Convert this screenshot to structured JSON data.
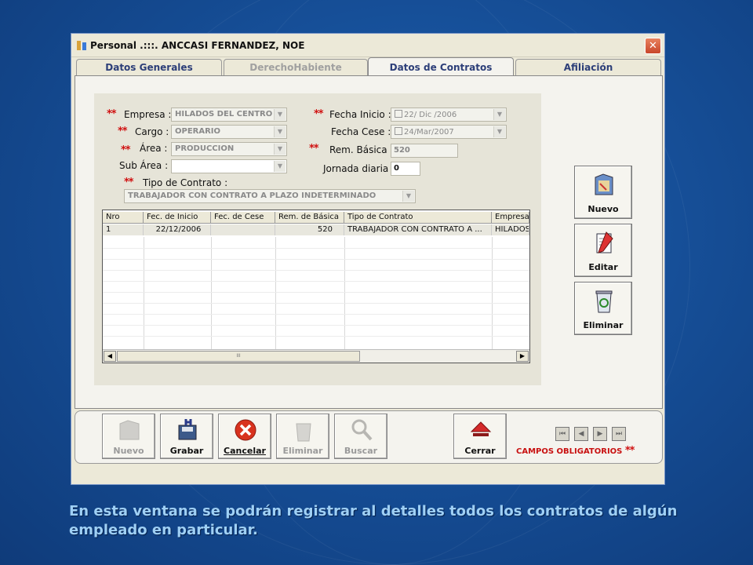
{
  "window": {
    "title": "Personal .:::. ANCCASI FERNANDEZ, NOE",
    "close_glyph": "✕"
  },
  "tabs": [
    {
      "label": "Datos Generales",
      "state": "normal"
    },
    {
      "label": "DerechoHabiente",
      "state": "disabled"
    },
    {
      "label": "Datos de Contratos",
      "state": "active"
    },
    {
      "label": "Afiliación",
      "state": "normal"
    }
  ],
  "form": {
    "required_mark": "**",
    "empresa": {
      "label": "Empresa :",
      "value": "HILADOS DEL CENTRO S"
    },
    "cargo": {
      "label": "Cargo :",
      "value": "OPERARIO"
    },
    "area": {
      "label": "Área :",
      "value": "PRODUCCION"
    },
    "sub_area": {
      "label": "Sub Área :",
      "value": ""
    },
    "fecha_inicio": {
      "label": "Fecha Inicio :",
      "value": "22/ Dic /2006"
    },
    "fecha_cese": {
      "label": "Fecha Cese :",
      "value": "24/Mar/2007"
    },
    "rem_basica": {
      "label": "Rem. Básica :",
      "value": "520"
    },
    "jornada_diaria": {
      "label": "Jornada diaria :",
      "value": "0"
    },
    "tipo_contrato": {
      "label": "Tipo de Contrato :",
      "value": "TRABAJADOR CON CONTRATO A PLAZO INDETERMINADO"
    }
  },
  "grid": {
    "columns": [
      "Nro",
      "Fec. de Inicio",
      "Fec. de Cese",
      "Rem. de Básica",
      "Tipo de Contrato",
      "Empresa"
    ],
    "rows": [
      [
        "1",
        "22/12/2006",
        "",
        "520",
        "TRABAJADOR CON CONTRATO A ...",
        "HILADOS"
      ]
    ],
    "scroll_thumb_glyph": "III"
  },
  "side_buttons": {
    "nuevo": "Nuevo",
    "editar": "Editar",
    "eliminar": "Eliminar"
  },
  "toolbar": {
    "nuevo": "Nuevo",
    "grabar": "Grabar",
    "cancelar": "Cancelar",
    "eliminar": "Eliminar",
    "buscar": "Buscar",
    "cerrar": "Cerrar"
  },
  "campos_obligatorios": "CAMPOS OBLIGATORIOS",
  "caption": "En esta ventana se podrán registrar al  detalles  todos los contratos de algún  empleado en particular.",
  "colors": {
    "background": "#164f98",
    "required": "#d01010",
    "caption": "#9fd0f5"
  }
}
